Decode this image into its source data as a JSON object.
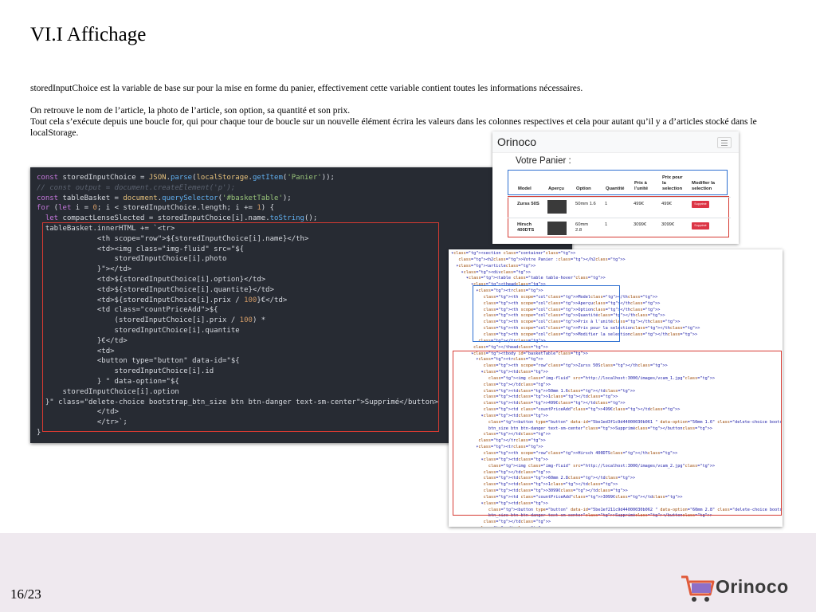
{
  "slide": {
    "title": "VI.I Affichage",
    "paragraph1": "storedInputChoice est la variable de base sur pour la mise en forme du panier, effectivement cette variable contient toutes les informations nécessaires.",
    "paragraph2_line1": "On retrouve le nom de l’article, la photo de l’article, son option, sa quantité et son prix.",
    "paragraph2_line2": "Tout cela s’exécute depuis une boucle for, qui pour chaque tour de boucle sur un nouvelle élément écrira les valeurs dans les colonnes respectives et cela pour autant qu’il y a d’articles stocké dans le localStorage.",
    "page_number": "16/23",
    "logo_text": "Orinoco"
  },
  "code_lines": [
    "const storedInputChoice = JSON.parse(localStorage.getItem('Panier'));",
    "// const output = document.createElement('p');",
    "const tableBasket = document.querySelector('#basketTable');",
    "for (let i = 0; i < storedInputChoice.length; i += 1) {",
    "  let compactLenseSlected = storedInputChoice[i].name.toString();",
    "  tableBasket.innerHTML += `<tr>",
    "              <th scope=\"row\">${storedInputChoice[i].name}</th>",
    "              <td><img class=\"img-fluid\" src=\"${",
    "                  storedInputChoice[i].photo",
    "              }\"></td>",
    "              <td>${storedInputChoice[i].option}</td>",
    "              <td>${storedInputChoice[i].quantite}</td>",
    "              <td>${storedInputChoice[i].prix / 100}€</td>",
    "              <td class=\"countPriceAdd\">${",
    "                  (storedInputChoice[i].prix / 100) *",
    "                  storedInputChoice[i].quantite",
    "              }€</td>",
    "              <td>",
    "              <button type=\"button\" data-id=\"${",
    "                  storedInputChoice[i].id",
    "              } \" data-option=\"${",
    "      storedInputChoice[i].option",
    "  }\" class=\"delete-choice bootstrap_btn_size btn btn-danger text-sm-center\">Supprimé</button>",
    "              </td>",
    "              </tr>`;",
    "}"
  ],
  "basket": {
    "brand": "Orinoco",
    "title": "Votre Panier :",
    "headers": [
      "Model",
      "Aperçu",
      "Option",
      "Quantité",
      "Prix à l’unité",
      "Prix pour la selection",
      "Modifier la selection"
    ],
    "rows": [
      {
        "model": "Zurss 50S",
        "option": "50mm 1.6",
        "quantite": "1",
        "prix": "499€",
        "total": "499€",
        "button": "Supprimé"
      },
      {
        "model": "Hirsch 400DTS",
        "option": "60mm 2.8",
        "quantite": "1",
        "prix": "3099€",
        "total": "3099€",
        "button": "Supprimé"
      }
    ]
  },
  "dom_lines": [
    "▾<section class=\"container\">",
    "   <h2>Votre Panier :</h2>",
    "  ▾<article>",
    "    ▾<div>",
    "      ▾<table class=\"table table-hover\">",
    "        ▾<thead>",
    "          ▾<tr>",
    "             <th scope=\"col\">Model</th>",
    "             <th scope=\"col\">Aperçu</th>",
    "             <th scope=\"col\">Option</th>",
    "             <th scope=\"col\">Quantité</th>",
    "             <th scope=\"col\">Prix à l'unité</th>",
    "             <th scope=\"col\">Prix pour la selection</th>",
    "             <th scope=\"col\">Modifier la selection</th>",
    "           </tr>",
    "         </thead>",
    "        ▾<tbody id=\"basketTable\">",
    "          ▾<tr>",
    "             <th scope=\"row\">Zurss 50S</th>",
    "            ▾<td>",
    "               <img class=\"img-fluid\" src=\"http://localhost:3000/images/vcam_1.jpg\">",
    "             </td>",
    "             <td>50mm 1.6</td>",
    "             <td>1</td>",
    "             <td>499€</td>",
    "             <td class=\"countPriceAdd\">499€</td>",
    "            ▾<td>",
    "               <button type=\"button\" data-id=\"5be1ed3f1c9d44000030b061 \" data-option=\"50mm 1.6\" class=\"delete-choice bootstrap_",
    "               btn_size btn btn-danger text-sm-center\">Supprimé</button>",
    "             </td>",
    "           </tr>",
    "          ▾<tr>",
    "             <th scope=\"row\">Hirsch 400DTS</th>",
    "            ▾<td>",
    "               <img class=\"img-fluid\" src=\"http://localhost:3000/images/vcam_2.jpg\">",
    "             </td>",
    "             <td>60mm 2.8</td>",
    "             <td>1</td>",
    "             <td>3099€</td>",
    "             <td class=\"countPriceAdd\">3099€</td>",
    "            ▾<td>",
    "               <button type=\"button\" data-id=\"5be1ef211c9d44000030b062 \" data-option=\"60mm 2.8\" class=\"delete-choice bootstrap_",
    "               btn_size btn btn-danger text-sm-center\">Supprimé</button>",
    "             </td>",
    "           </tr>",
    "         </tbody>",
    "       </table>"
  ],
  "colors": {
    "red_box": "#d63a32",
    "blue_box": "#2d6fd1",
    "code_bg": "#272b33",
    "footer_bg": "#efe9ef",
    "logo_cart": "#e05a3a"
  }
}
